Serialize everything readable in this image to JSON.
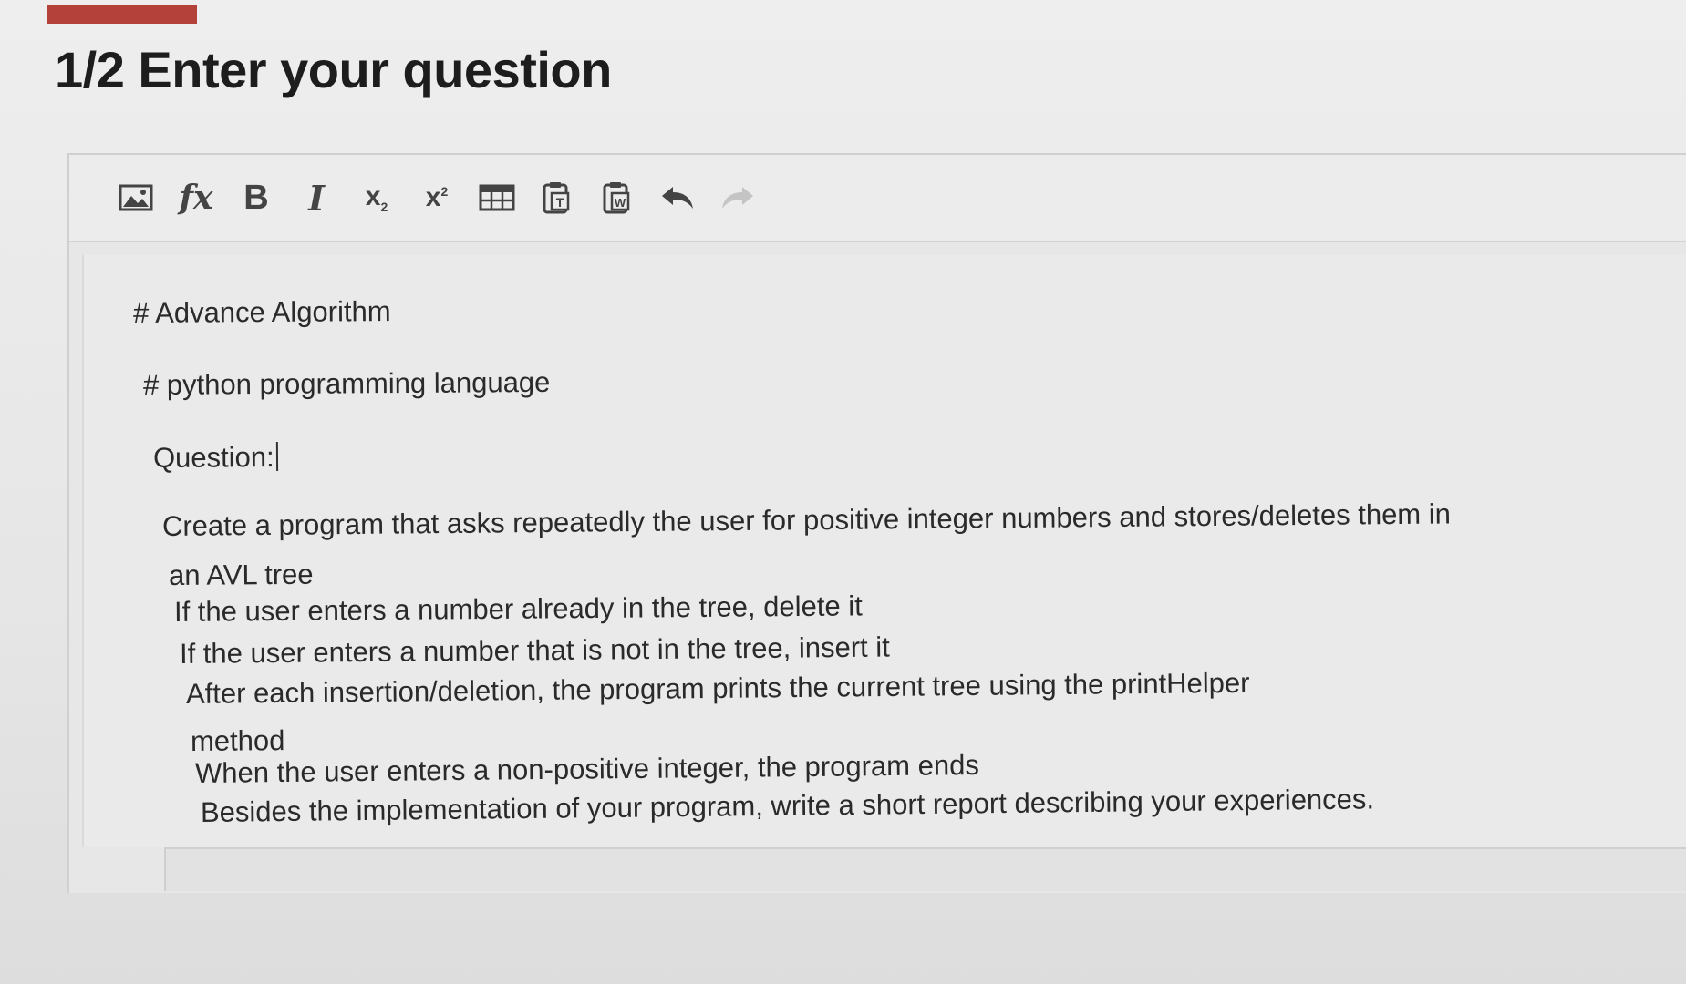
{
  "page": {
    "title": "1/2 Enter your question",
    "accent_color": "#b5413b"
  },
  "toolbar": {
    "items": [
      {
        "name": "insert-image",
        "icon": "image-icon"
      },
      {
        "name": "formula",
        "label": "fx"
      },
      {
        "name": "bold",
        "label": "B"
      },
      {
        "name": "italic",
        "label": "I"
      },
      {
        "name": "subscript",
        "label": "x",
        "script": "2"
      },
      {
        "name": "superscript",
        "label": "x",
        "script": "2"
      },
      {
        "name": "insert-table",
        "icon": "table-icon"
      },
      {
        "name": "paste-text",
        "icon": "paste-text-icon"
      },
      {
        "name": "paste-word",
        "icon": "paste-word-icon"
      },
      {
        "name": "undo",
        "icon": "undo-icon"
      },
      {
        "name": "redo",
        "icon": "redo-icon"
      }
    ]
  },
  "editor": {
    "lines": [
      "# Advance Algorithm",
      "# python programming language",
      "Question:",
      "Create a program that asks repeatedly the user for positive integer numbers and stores/deletes them in",
      "an AVL tree",
      "If the user enters a number already in the tree, delete it",
      "If the user enters a number that is not in the tree, insert it",
      "After each insertion/deletion, the program prints the current tree using the printHelper",
      "method",
      "When the user enters a non-positive integer, the program ends",
      "Besides the implementation of your program, write a short report describing your experiences."
    ]
  }
}
